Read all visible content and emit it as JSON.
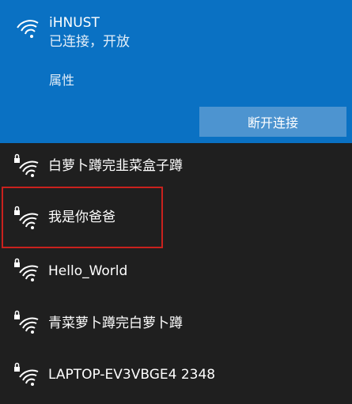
{
  "connected_network": {
    "name": "iHNUST",
    "status": "已连接，开放",
    "properties_label": "属性",
    "disconnect_label": "断开连接"
  },
  "networks": [
    {
      "name": "白萝卜蹲完韭菜盒子蹲"
    },
    {
      "name": "我是你爸爸"
    },
    {
      "name": "Hello_World"
    },
    {
      "name": "青菜萝卜蹲完白萝卜蹲"
    },
    {
      "name": "LAPTOP-EV3VBGE4 2348"
    }
  ],
  "colors": {
    "accent_blue": "#0a71c3",
    "button_blue": "#4d94d0",
    "panel_dark": "#1f1f1f",
    "annotation_red": "#c9211d"
  },
  "icons": [
    "wifi-icon",
    "wifi-secured-icon"
  ]
}
